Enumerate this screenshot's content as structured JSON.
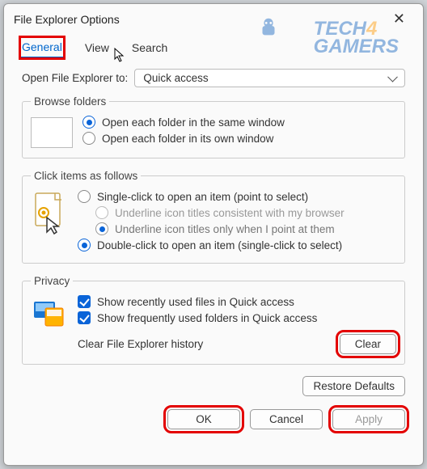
{
  "title": "File Explorer Options",
  "watermark": {
    "line1a": "TECH",
    "line1b": "4",
    "line2": "GAMERS"
  },
  "tabs": {
    "general": "General",
    "view": "View",
    "search": "Search"
  },
  "open_to": {
    "label": "Open File Explorer to:",
    "value": "Quick access"
  },
  "browse_folders": {
    "legend": "Browse folders",
    "opt_same": "Open each folder in the same window",
    "opt_own": "Open each folder in its own window"
  },
  "click_items": {
    "legend": "Click items as follows",
    "single": "Single-click to open an item (point to select)",
    "underline_browser": "Underline icon titles consistent with my browser",
    "underline_point": "Underline icon titles only when I point at them",
    "double": "Double-click to open an item (single-click to select)"
  },
  "privacy": {
    "legend": "Privacy",
    "recent_files": "Show recently used files in Quick access",
    "freq_folders": "Show frequently used folders in Quick access",
    "clear_label": "Clear File Explorer history",
    "clear_btn": "Clear"
  },
  "restore_defaults": "Restore Defaults",
  "footer": {
    "ok": "OK",
    "cancel": "Cancel",
    "apply": "Apply"
  }
}
